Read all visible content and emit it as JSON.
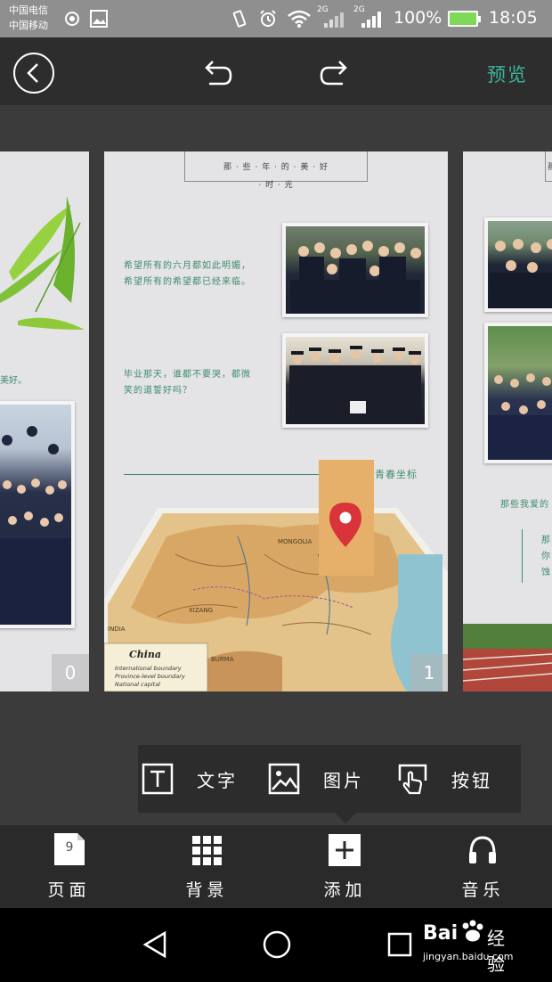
{
  "status_bar": {
    "carrier_1": "中国电信",
    "carrier_2": "中国移动",
    "signal_2g_a": "2G",
    "signal_2g_b": "2G",
    "battery_percent": "100%",
    "time": "18:05"
  },
  "toolbar": {
    "preview_label": "预览"
  },
  "pages": {
    "left": {
      "number": "0",
      "text_fragment": "美好。"
    },
    "center": {
      "number": "1",
      "title_line_1": "那 · 些 · 年 · 的 · 美 · 好",
      "title_line_2": "· 时 · 光",
      "text_1_line_1": "希望所有的六月都如此明媚，",
      "text_1_line_2": "希望所有的希望都已经来临。",
      "text_2_line_1": "毕业那天，谁都不要哭，都微",
      "text_2_line_2": "笑的道誓好吗？",
      "map_caption": "我们的青春坐标",
      "map_title": "China",
      "legend_1": "International boundary",
      "legend_2": "Province-level boundary",
      "legend_3": "National capital",
      "map_labels": [
        "MONGOLIA",
        "XIZANG",
        "INDIA",
        "BURMA"
      ]
    },
    "right": {
      "title_fragment": "那",
      "text_fragment": "那些我爱的",
      "side_1": "那",
      "side_2": "你",
      "side_3": "蚀"
    }
  },
  "insert_panel": {
    "text_label": "文字",
    "image_label": "图片",
    "button_label": "按钮"
  },
  "tabs": {
    "page_count": "9",
    "page_label": "页面",
    "background_label": "背景",
    "add_label": "添加",
    "music_label": "音乐"
  },
  "watermark": {
    "brand_prefix": "Bai",
    "brand_suffix": "经验",
    "url": "jingyan.baidu.com"
  },
  "colors": {
    "accent_green": "#3fb39a",
    "page_text_green": "#3e8c6e",
    "map_marker": "#d8343a",
    "marker_panel": "#e6b06a"
  }
}
